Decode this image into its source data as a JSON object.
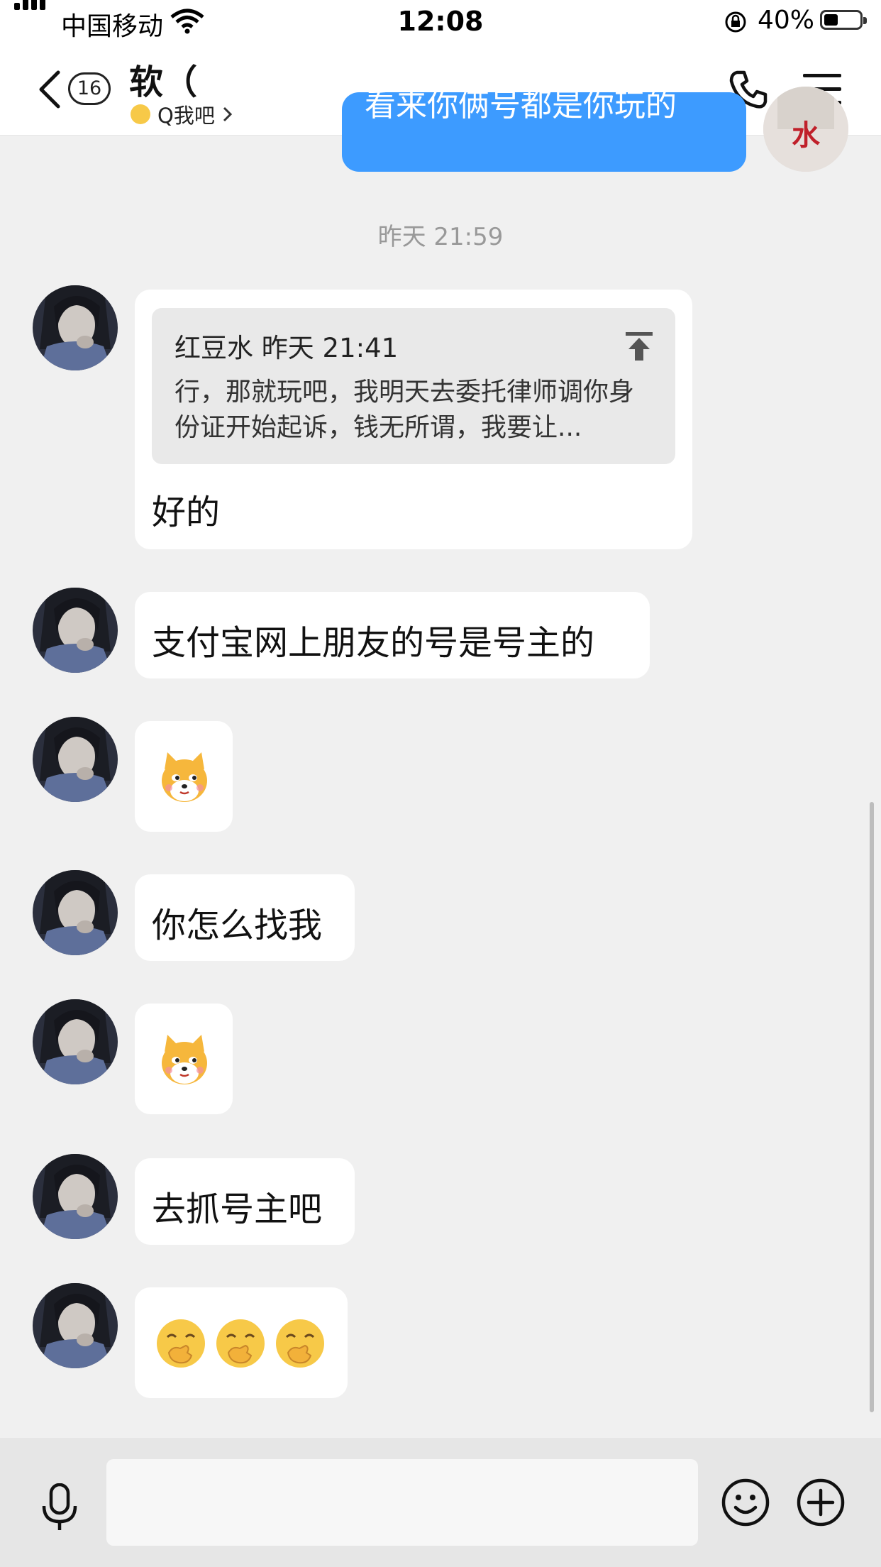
{
  "status_bar": {
    "carrier": "中国移动",
    "time": "12:08",
    "battery": "40%",
    "battery_level": 0.4
  },
  "header": {
    "unread_count": "16",
    "title": "软（",
    "subtitle": "Q我吧"
  },
  "sent_partial": {
    "text": "看来你俩号都是你玩的",
    "avatar_char": "水"
  },
  "timestamp": "昨天 21:59",
  "quote": {
    "author": "红豆水",
    "time": "昨天 21:41",
    "text": "行，那就玩吧，我明天去委托律师调你身份证开始起诉，钱无所谓，我要让..."
  },
  "messages": [
    {
      "type": "text",
      "text": "好的"
    },
    {
      "type": "text",
      "text": "支付宝网上朋友的号是号主的"
    },
    {
      "type": "emoji",
      "emoji": "dog-face"
    },
    {
      "type": "text",
      "text": "你怎么找我"
    },
    {
      "type": "emoji",
      "emoji": "dog-face"
    },
    {
      "type": "text",
      "text": "去抓号主吧"
    },
    {
      "type": "emoji",
      "emoji": "hand-over-mouth x3"
    }
  ],
  "colors": {
    "sent_bubble": "#3d9bff",
    "background": "#f0f0f0"
  }
}
